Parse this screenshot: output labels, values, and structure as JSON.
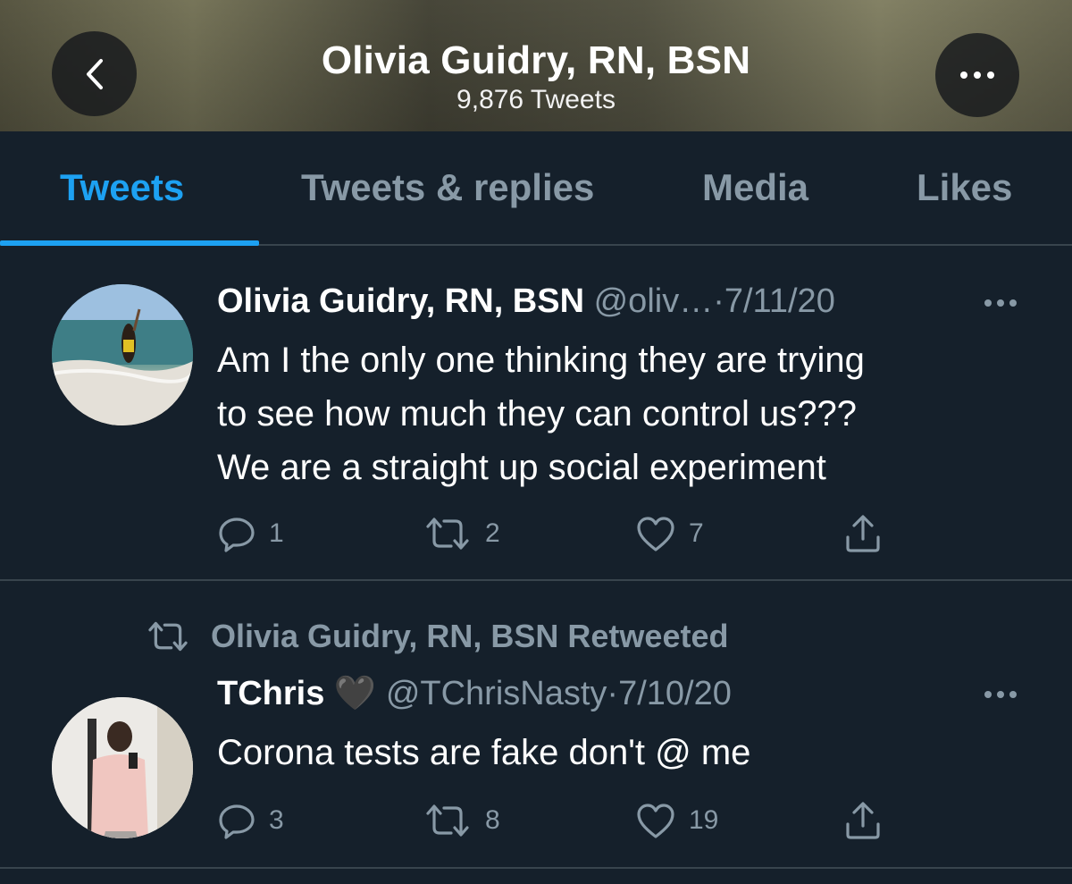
{
  "header": {
    "title": "Olivia Guidry, RN, BSN",
    "tweet_count": "9,876 Tweets",
    "back_icon": "chevron-left-icon",
    "more_icon": "more-horizontal-icon"
  },
  "tabs": [
    {
      "label": "Tweets",
      "active": true
    },
    {
      "label": "Tweets & replies",
      "active": false
    },
    {
      "label": "Media",
      "active": false
    },
    {
      "label": "Likes",
      "active": false
    }
  ],
  "colors": {
    "accent": "#1da1f2",
    "background": "#15202b",
    "secondary_text": "#8899a6",
    "divider": "#38444d"
  },
  "tweets": [
    {
      "author_name": "Olivia Guidry, RN, BSN",
      "handle": "@oliv…",
      "separator": "·",
      "date": "7/11/20",
      "text": [
        "Am I the only one thinking they are trying",
        "to see how much they can control us???",
        "We are a straight up social experiment"
      ],
      "replies": "1",
      "retweets": "2",
      "likes": "7"
    },
    {
      "retweeted_by": "Olivia Guidry, RN, BSN Retweeted",
      "author_name": "TChris",
      "emoji": "🖤",
      "handle": "@TChrisNasty",
      "separator": "·",
      "date": "7/10/20",
      "text": [
        "Corona tests are fake don't @ me"
      ],
      "replies": "3",
      "retweets": "8",
      "likes": "19"
    }
  ]
}
